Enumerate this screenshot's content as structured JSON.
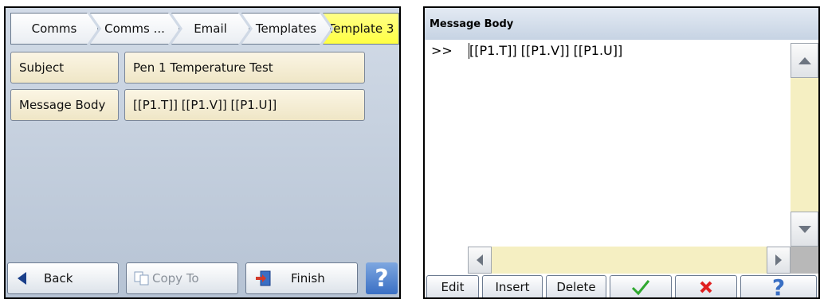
{
  "breadcrumb": {
    "items": [
      "Comms",
      "Comms ...",
      "Email",
      "Templates",
      "Template 3"
    ]
  },
  "rows": [
    {
      "label": "Subject",
      "value": "Pen 1 Temperature Test"
    },
    {
      "label": "Message Body",
      "value": "[[P1.T]] [[P1.V]] [[P1.U]]"
    }
  ],
  "bottom": {
    "back": "Back",
    "copy_to": "Copy To",
    "finish": "Finish",
    "help": "?"
  },
  "editor": {
    "title": "Message Body",
    "prompt": ">>",
    "text": "[[P1.T]] [[P1.V]] [[P1.U]]"
  },
  "editor_bottom": {
    "edit": "Edit",
    "insert": "Insert",
    "delete": "Delete",
    "help": "?"
  },
  "colors": {
    "accent_yellow": "#ffff40",
    "ok_green": "#2fa82f",
    "cancel_red": "#e02020",
    "help_blue": "#3a6fc4"
  }
}
